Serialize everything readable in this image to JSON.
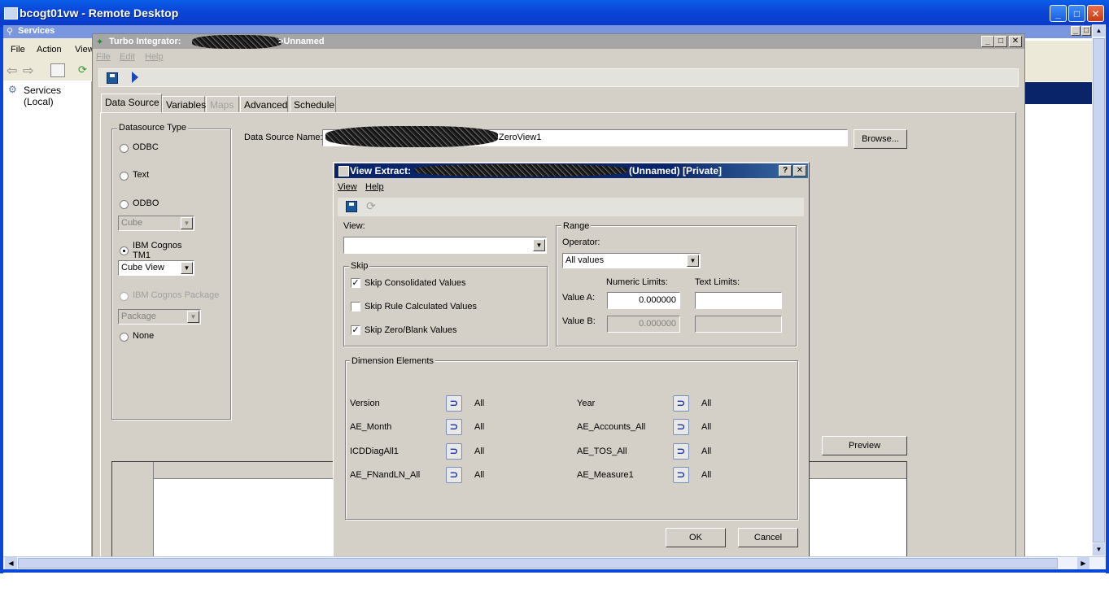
{
  "remote_desktop": {
    "title": "bcogt01vw - Remote Desktop"
  },
  "services": {
    "title": "Services",
    "menu": [
      "File",
      "Action",
      "View"
    ],
    "tree_item": "Services (Local)"
  },
  "turbo_integrator": {
    "title_prefix": "Turbo Integrator:",
    "title_suffix": ">Unnamed",
    "menu": [
      "File",
      "Edit",
      "Help"
    ],
    "tabs": [
      "Data Source",
      "Variables",
      "Maps",
      "Advanced",
      "Schedule"
    ],
    "datasource_type": {
      "label": "Datasource Type",
      "options": [
        "ODBC",
        "Text",
        "ODBO",
        "IBM Cognos TM1",
        "IBM Cognos Package",
        "None"
      ],
      "odbo_combo": "Cube",
      "tm1_combo": "Cube View",
      "package_combo": "Package"
    },
    "data_source_name_label": "Data Source Name:",
    "data_source_name_value": "ZeroView1",
    "browse_button": "Browse...",
    "preview_button": "Preview"
  },
  "view_extract": {
    "title_prefix": "View Extract:",
    "title_suffix": "(Unnamed)  [Private]",
    "menu": [
      "View",
      "Help"
    ],
    "view_label": "View:",
    "view_value": "",
    "skip": {
      "label": "Skip",
      "items": [
        {
          "label": "Skip Consolidated Values",
          "checked": true
        },
        {
          "label": "Skip Rule Calculated Values",
          "checked": false
        },
        {
          "label": "Skip Zero/Blank Values",
          "checked": true
        }
      ]
    },
    "range": {
      "label": "Range",
      "operator_label": "Operator:",
      "operator_value": "All values",
      "numeric_limits": "Numeric Limits:",
      "text_limits": "Text Limits:",
      "value_a_label": "Value A:",
      "value_a": "0.000000",
      "value_b_label": "Value B:",
      "value_b": "0.000000"
    },
    "dimension_elements": {
      "label": "Dimension Elements",
      "left": [
        {
          "name": "Version",
          "value": "All"
        },
        {
          "name": "AE_Month",
          "value": "All"
        },
        {
          "name": "ICDDiagAll1",
          "value": "All"
        },
        {
          "name": "AE_FNandLN_All",
          "value": "All"
        }
      ],
      "right": [
        {
          "name": "Year",
          "value": "All"
        },
        {
          "name": "AE_Accounts_All",
          "value": "All"
        },
        {
          "name": "AE_TOS_All",
          "value": "All"
        },
        {
          "name": "AE_Measure1",
          "value": "All"
        }
      ]
    },
    "ok_button": "OK",
    "cancel_button": "Cancel"
  },
  "glyphs": {
    "help": "?",
    "close": "✕",
    "minimize": "_",
    "maximize": "□"
  }
}
